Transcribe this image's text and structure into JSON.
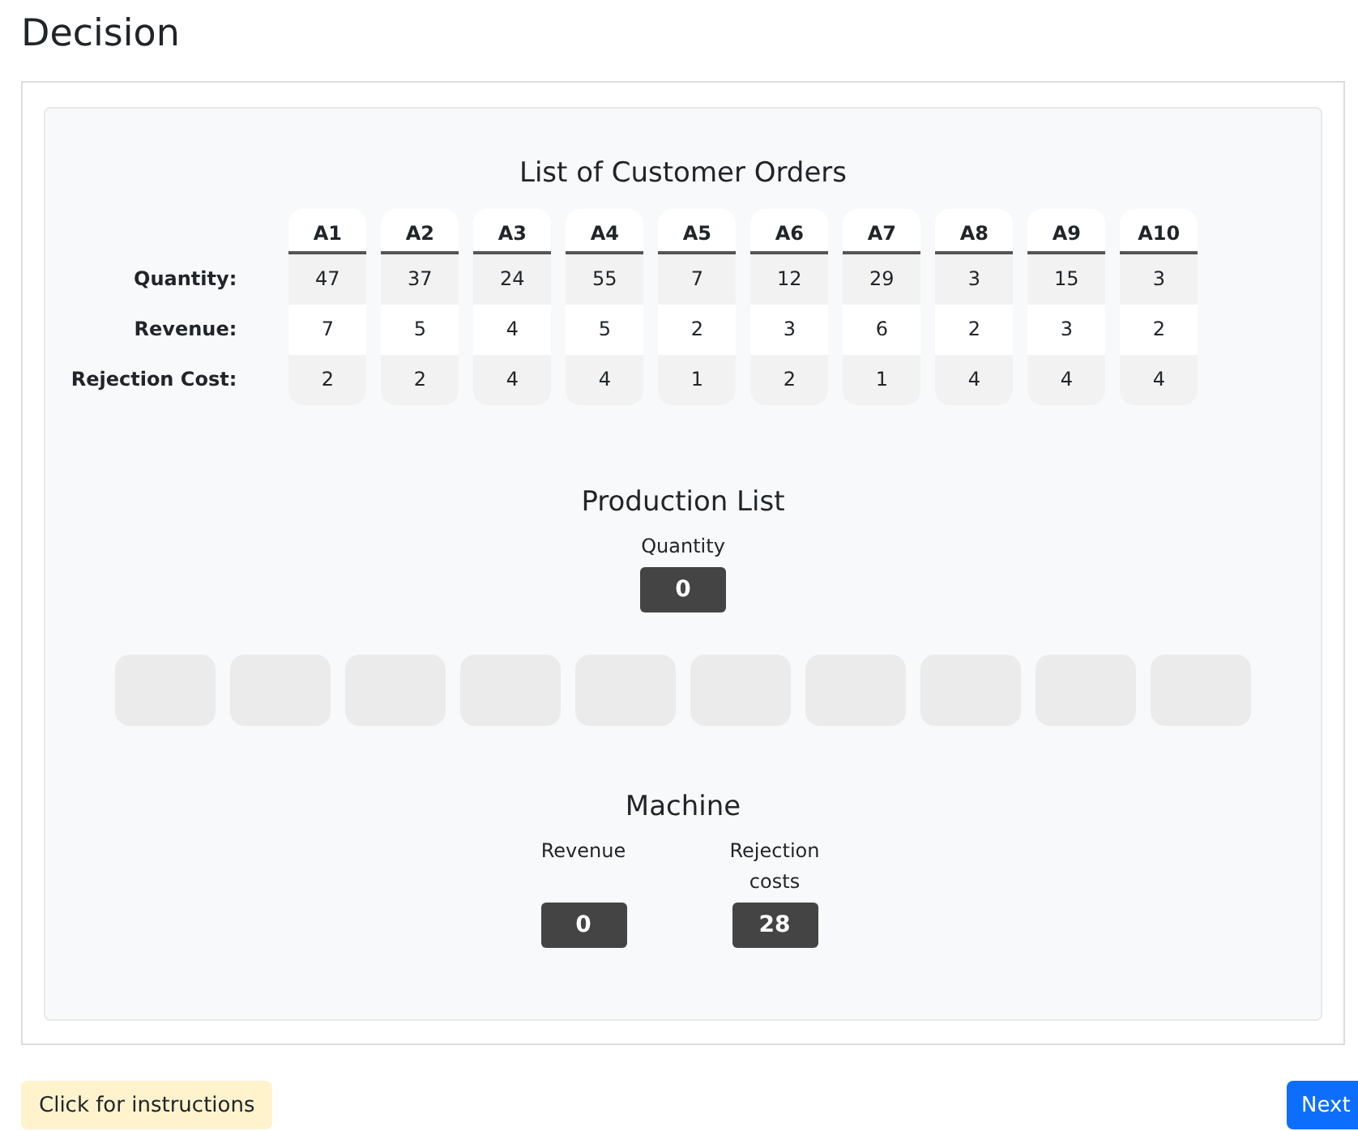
{
  "page_title": "Decision",
  "orders_section": {
    "title": "List of Customer Orders",
    "row_labels": [
      "Quantity:",
      "Revenue:",
      "Rejection Cost:"
    ],
    "orders": [
      {
        "label": "A1",
        "quantity": "47",
        "revenue": "7",
        "rejection_cost": "2"
      },
      {
        "label": "A2",
        "quantity": "37",
        "revenue": "5",
        "rejection_cost": "2"
      },
      {
        "label": "A3",
        "quantity": "24",
        "revenue": "4",
        "rejection_cost": "4"
      },
      {
        "label": "A4",
        "quantity": "55",
        "revenue": "5",
        "rejection_cost": "4"
      },
      {
        "label": "A5",
        "quantity": "7",
        "revenue": "2",
        "rejection_cost": "1"
      },
      {
        "label": "A6",
        "quantity": "12",
        "revenue": "3",
        "rejection_cost": "2"
      },
      {
        "label": "A7",
        "quantity": "29",
        "revenue": "6",
        "rejection_cost": "1"
      },
      {
        "label": "A8",
        "quantity": "3",
        "revenue": "2",
        "rejection_cost": "4"
      },
      {
        "label": "A9",
        "quantity": "15",
        "revenue": "3",
        "rejection_cost": "4"
      },
      {
        "label": "A10",
        "quantity": "3",
        "revenue": "2",
        "rejection_cost": "4"
      }
    ]
  },
  "production_section": {
    "title": "Production List",
    "quantity_label": "Quantity",
    "quantity_value": "0",
    "slots": [
      {
        "kind": "empty"
      },
      {
        "kind": "empty"
      },
      {
        "kind": "empty"
      },
      {
        "kind": "empty"
      },
      {
        "kind": "empty"
      },
      {
        "kind": "empty"
      },
      {
        "kind": "empty"
      },
      {
        "kind": "empty"
      },
      {
        "kind": "empty"
      },
      {
        "kind": "empty"
      }
    ]
  },
  "machine_section": {
    "title": "Machine",
    "stats": [
      {
        "label": "Revenue",
        "value": "0"
      },
      {
        "label": "Rejection costs",
        "value": "28"
      }
    ]
  },
  "buttons": {
    "instructions": "Click for instructions",
    "next": "Next"
  }
}
